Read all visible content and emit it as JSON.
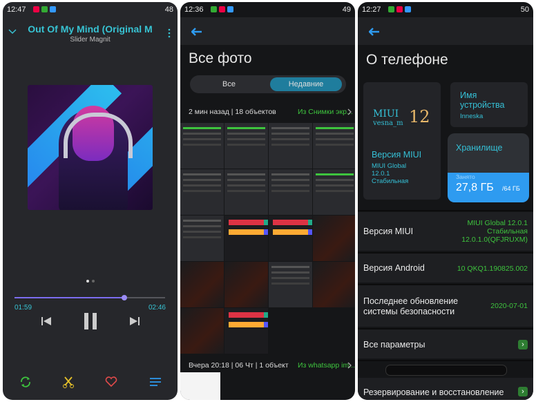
{
  "colors": {
    "accent_cyan": "#37c3d3",
    "accent_green": "#3ec43e",
    "accent_blue": "#1f7d9d",
    "storage_blue": "#2e9bf0"
  },
  "phone1": {
    "status": {
      "time": "12:47",
      "battery": "48"
    },
    "title": "Out Of My Mind (Original M",
    "artist": "Slider Magnit",
    "progress_fraction": 0.73,
    "elapsed": "01:59",
    "duration": "02:46",
    "icons": [
      "chevron-down-icon",
      "more-icon",
      "previous-icon",
      "pause-icon",
      "next-icon",
      "repeat-icon",
      "cut-icon",
      "heart-icon",
      "playlist-icon"
    ]
  },
  "phone2": {
    "status": {
      "time": "12:36",
      "battery": "49"
    },
    "title": "Все фото",
    "tabs": [
      "Все",
      "Недавние"
    ],
    "active_tab": "Недавние",
    "group1": {
      "label": "2 мин назад | 18 объектов",
      "source": "Из Снимки экр..."
    },
    "group2": {
      "label": "Вчера 20:18 | 06 Чт | 1 объект",
      "source": "Из whatsapp im..."
    }
  },
  "phone3": {
    "status": {
      "time": "12:27",
      "battery": "50"
    },
    "title": "О телефоне",
    "logo": {
      "text": "MIUI",
      "sub": "vesna_m",
      "num": "12"
    },
    "device_card": {
      "label": "Имя устройства",
      "value": "Inneska"
    },
    "miui_card": {
      "label": "Версия MIUI",
      "line1": "MIUI Global",
      "line2": "12.0.1",
      "line3": "Стабильная"
    },
    "storage_card": {
      "label": "Хранилище",
      "used_label": "Занято",
      "used": "27,8 ГБ",
      "total": "/64 ГБ",
      "used_fraction": 0.43
    },
    "rows": [
      {
        "label": "Версия MIUI",
        "value": "MIUI Global 12.0.1\nСтабильная\n12.0.1.0(QFJRUXM)"
      },
      {
        "label": "Версия Android",
        "value": "10 QKQ1.190825.002"
      },
      {
        "label": "Последнее обновление\nсистемы безопасности",
        "value": "2020-07-01"
      },
      {
        "label": "Все параметры",
        "value": ""
      },
      {
        "label": "Резервирование и восстановление",
        "value": ""
      }
    ]
  }
}
